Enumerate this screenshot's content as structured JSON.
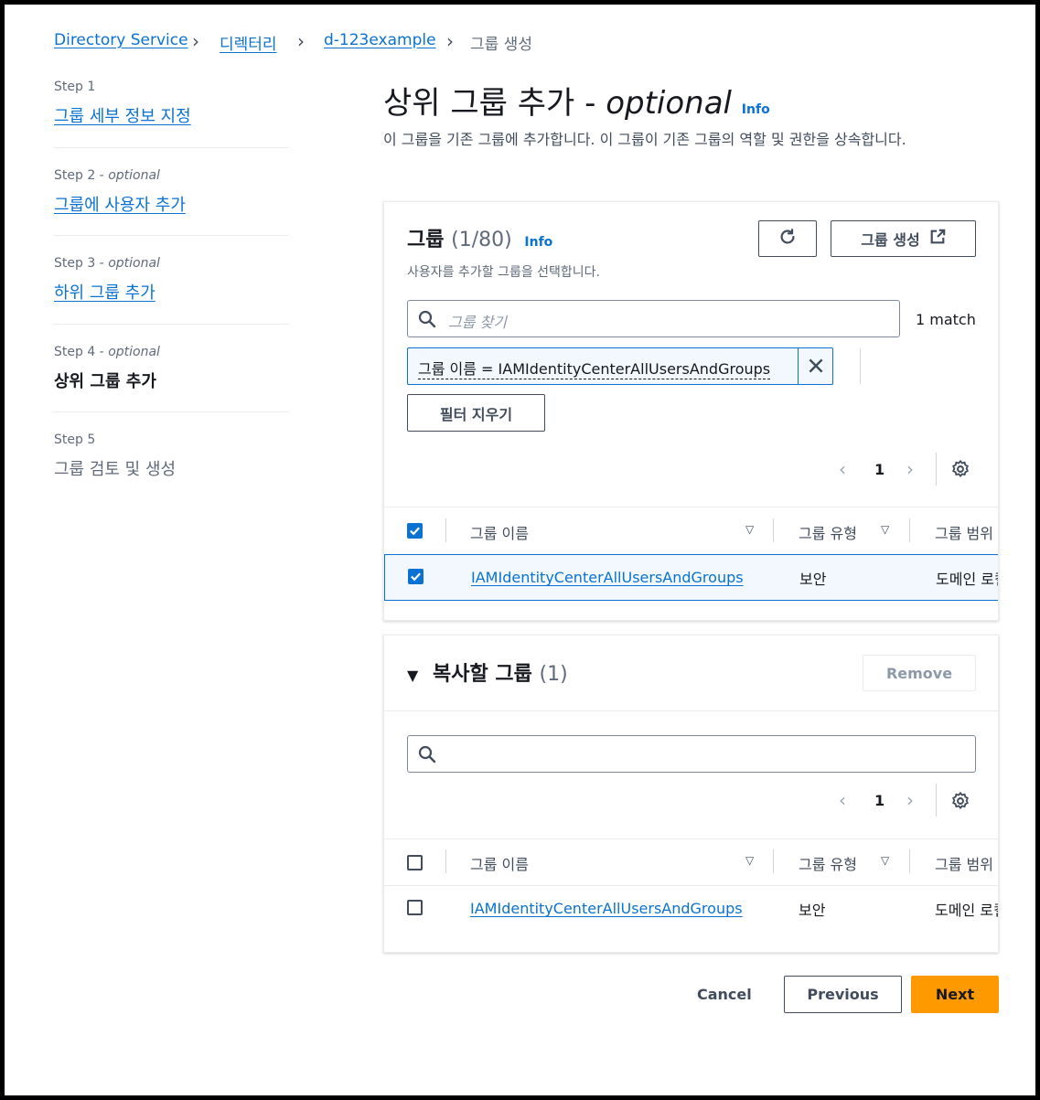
{
  "breadcrumb": {
    "items": [
      "Directory Service",
      "디렉터리",
      "d-123example"
    ],
    "current": "그룹 생성"
  },
  "steps": [
    {
      "label": "Step 1",
      "optional": "",
      "title": "그룹 세부 정보 지정"
    },
    {
      "label": "Step 2",
      "optional": "optional",
      "title": "그룹에 사용자 추가"
    },
    {
      "label": "Step 3",
      "optional": "optional",
      "title": "하위 그룹 추가"
    },
    {
      "label": "Step 4",
      "optional": "optional",
      "title": "상위 그룹 추가"
    },
    {
      "label": "Step 5",
      "optional": "",
      "title": "그룹 검토 및 생성"
    }
  ],
  "page": {
    "title": "상위 그룹 추가",
    "title_optional": "optional",
    "info": "Info",
    "description": "이 그룹을 기존 그룹에 추가합니다. 이 그룹이 기존 그룹의 역할 및 권한을 상속합니다."
  },
  "groups_panel": {
    "title": "그룹",
    "count": "(1/80)",
    "info": "Info",
    "subtitle": "사용자를 추가할 그룹을 선택합니다.",
    "create_button": "그룹 생성",
    "search_placeholder": "그룹 찾기",
    "match_text": "1 match",
    "filter_token": "그룹 이름 = IAMIdentityCenterAllUsersAndGroups",
    "clear_filter": "필터 지우기",
    "page": "1",
    "columns": [
      "그룹 이름",
      "그룹 유형",
      "그룹 범위"
    ],
    "rows": [
      {
        "name": "IAMIdentityCenterAllUsersAndGroups",
        "type": "보안",
        "scope": "도메인 로컬"
      }
    ]
  },
  "copy_panel": {
    "title": "복사할 그룹",
    "count": "(1)",
    "remove_button": "Remove",
    "page": "1",
    "columns": [
      "그룹 이름",
      "그룹 유형",
      "그룹 범위"
    ],
    "rows": [
      {
        "name": "IAMIdentityCenterAllUsersAndGroups",
        "type": "보안",
        "scope": "도메인 로컬"
      }
    ]
  },
  "footer": {
    "cancel": "Cancel",
    "previous": "Previous",
    "next": "Next"
  },
  "colors": {
    "link": "#0972d3",
    "primary": "#ff9900",
    "selected_row": "#f2f8fd"
  }
}
